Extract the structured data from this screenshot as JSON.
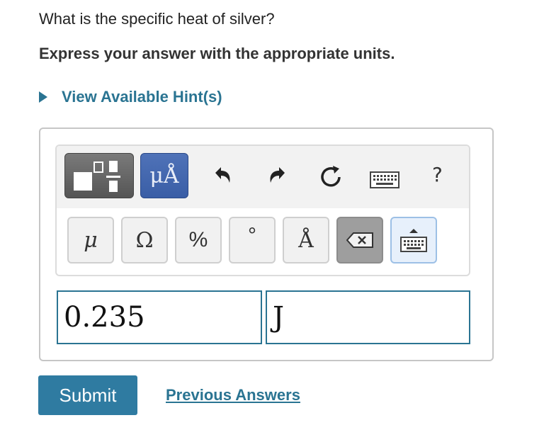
{
  "question": "What is the specific heat of silver?",
  "instruction": "Express your answer with the appropriate units.",
  "hint_label": "View Available Hint(s)",
  "toolbar": {
    "units_button_label": "μÅ",
    "help_label": "?"
  },
  "keypad": {
    "keys": [
      "μ",
      "Ω",
      "%",
      "°",
      "Å"
    ]
  },
  "answer": {
    "value": "0.235",
    "units": "J"
  },
  "colors": {
    "accent": "#2a7492",
    "submit": "#2f7ba1",
    "units_button": "#4a6db4"
  },
  "actions": {
    "submit_label": "Submit",
    "previous_answers_label": "Previous Answers"
  }
}
